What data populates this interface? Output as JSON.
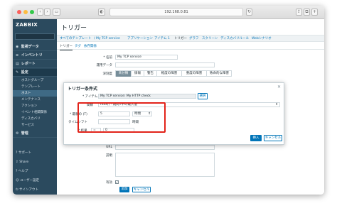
{
  "browser": {
    "address": "192.168.0.81"
  },
  "sidebar": {
    "logo": "ZABBIX",
    "sections": [
      {
        "icon": "eye-icon",
        "glyph": "◉",
        "label": "監視データ"
      },
      {
        "icon": "list-icon",
        "glyph": "≡",
        "label": "インベントリ"
      },
      {
        "icon": "chart-icon",
        "glyph": "▤",
        "label": "レポート"
      },
      {
        "icon": "wrench-icon",
        "glyph": "✎",
        "label": "設定"
      }
    ],
    "config_items": [
      "ホストグループ",
      "テンプレート",
      "ホスト",
      "メンテナンス",
      "アクション",
      "イベント相関関係",
      "ディスカバリ",
      "サービス"
    ],
    "admin": {
      "icon": "gear-icon",
      "glyph": "⚙",
      "label": "管理"
    },
    "bottom": [
      {
        "icon": "support-icon",
        "glyph": "?",
        "label": "サポート"
      },
      {
        "icon": "share-icon",
        "glyph": "⇪",
        "label": "Share"
      },
      {
        "icon": "help-icon",
        "glyph": "?",
        "label": "ヘルプ"
      },
      {
        "icon": "user-icon",
        "glyph": "☺",
        "label": "ユーザー設定"
      },
      {
        "icon": "power-icon",
        "glyph": "⏻",
        "label": "サインアウト"
      }
    ]
  },
  "main": {
    "title": "トリガー",
    "breadcrumb": [
      "すべてのテンプレート",
      "/ My TCP service",
      "アプリケーション",
      "アイテム 1",
      "トリガー",
      "グラフ",
      "スクリーン",
      "ディスカバリルール",
      "Webシナリオ"
    ],
    "subtabs": [
      "トリガー",
      "タグ",
      "依存関係"
    ],
    "form": {
      "name_label": "* 名前",
      "name_value": "My TCP service",
      "opdata_label": "運用データ",
      "severity_label": "深刻度",
      "severity_options": [
        "未分類",
        "情報",
        "警告",
        "軽度の障害",
        "重度の障害",
        "致命的な障害"
      ],
      "url_label": "URL",
      "desc_label": "説明",
      "enabled_label": "有効",
      "add_button": "追加",
      "cancel_button": "キャンセル"
    }
  },
  "modal": {
    "title": "トリガー条件式",
    "item_label": "* アイテム",
    "item_value": "My TCP service: My HTTP check",
    "select_button": "選択",
    "function_label": "関数",
    "function_value": "max() - 期間T中の最大値",
    "last_label": "* 最新の (T)",
    "last_value": "5",
    "last_unit": "時間",
    "shift_label": "タイムシフト",
    "shift_unit": "時間",
    "result_label": "* 結果",
    "result_op": "=",
    "result_value": "0",
    "insert_button": "挿入",
    "cancel_button": "キャンセル"
  }
}
